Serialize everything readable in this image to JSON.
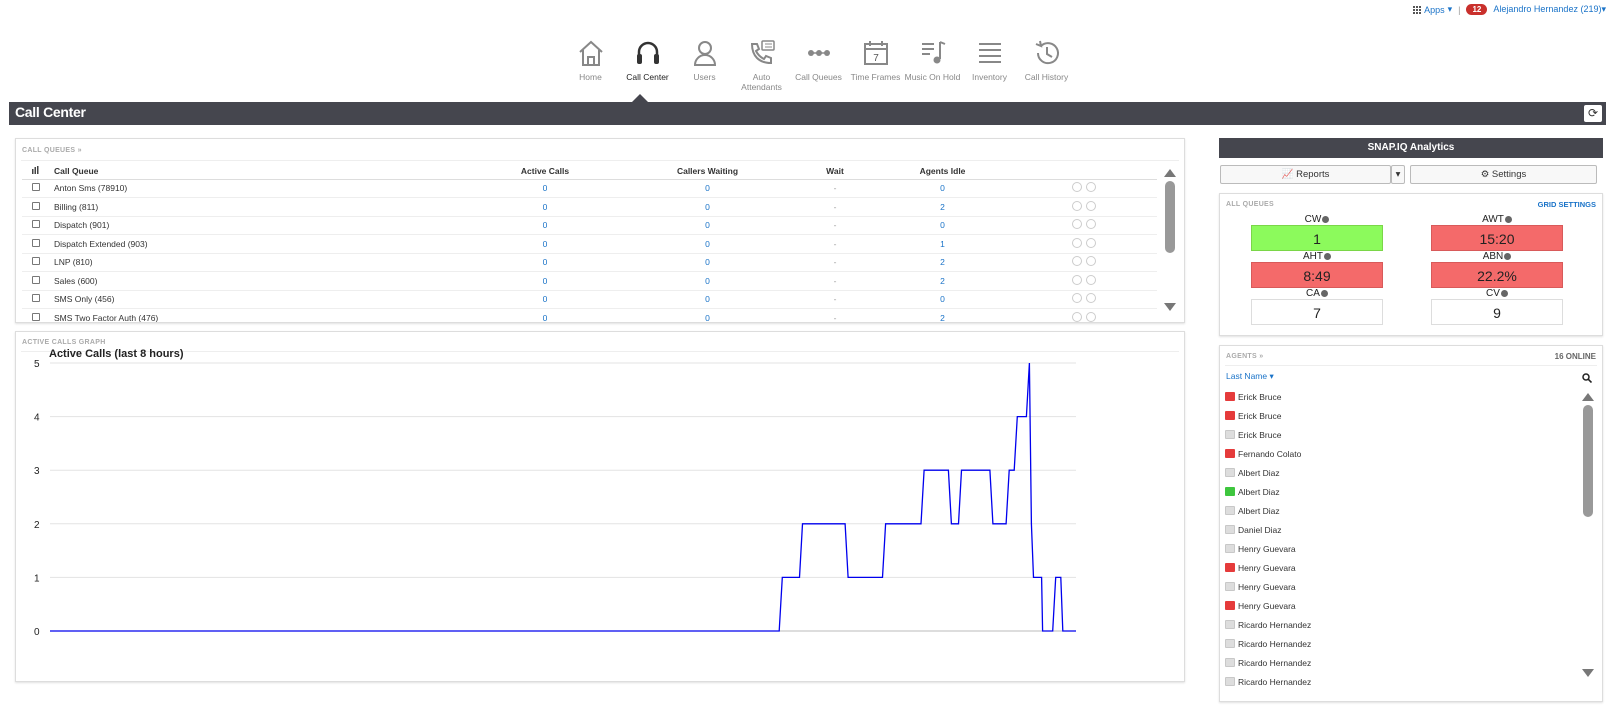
{
  "topbar": {
    "apps_label": "Apps",
    "notifications": "12",
    "user": "Alejandro Hernandez (219)"
  },
  "nav": [
    {
      "label": "Home",
      "icon": "home-icon"
    },
    {
      "label": "Call Center",
      "icon": "headset-icon"
    },
    {
      "label": "Users",
      "icon": "user-icon"
    },
    {
      "label": "Auto Attendants",
      "icon": "auto-attendant-icon"
    },
    {
      "label": "Call Queues",
      "icon": "call-queues-icon"
    },
    {
      "label": "Time Frames",
      "icon": "calendar-icon"
    },
    {
      "label": "Music On Hold",
      "icon": "music-icon"
    },
    {
      "label": "Inventory",
      "icon": "list-icon"
    },
    {
      "label": "Call History",
      "icon": "history-icon"
    }
  ],
  "page": {
    "title": "Call Center"
  },
  "queues": {
    "label": "CALL QUEUES »",
    "columns": [
      "Call Queue",
      "Active Calls",
      "Callers Waiting",
      "Wait",
      "Agents Idle"
    ],
    "rows": [
      {
        "name": "Anton Sms (78910)",
        "active": "0",
        "waiting": "0",
        "wait": "-",
        "idle": "0"
      },
      {
        "name": "Billing (811)",
        "active": "0",
        "waiting": "0",
        "wait": "-",
        "idle": "2"
      },
      {
        "name": "Dispatch (901)",
        "active": "0",
        "waiting": "0",
        "wait": "-",
        "idle": "0"
      },
      {
        "name": "Dispatch Extended (903)",
        "active": "0",
        "waiting": "0",
        "wait": "-",
        "idle": "1"
      },
      {
        "name": "LNP (810)",
        "active": "0",
        "waiting": "0",
        "wait": "-",
        "idle": "2"
      },
      {
        "name": "Sales (600)",
        "active": "0",
        "waiting": "0",
        "wait": "-",
        "idle": "2"
      },
      {
        "name": "SMS Only (456)",
        "active": "0",
        "waiting": "0",
        "wait": "-",
        "idle": "0"
      },
      {
        "name": "SMS Two Factor Auth (476)",
        "active": "0",
        "waiting": "0",
        "wait": "-",
        "idle": "2"
      }
    ]
  },
  "graph": {
    "label": "ACTIVE CALLS GRAPH",
    "chart_data": {
      "type": "line",
      "title": "Active Calls (last 8 hours)",
      "ylim": [
        0,
        5
      ],
      "yticks": [
        "0",
        "1",
        "2",
        "3",
        "4",
        "5"
      ],
      "x": [
        0,
        720,
        723,
        740,
        743,
        785,
        788,
        822,
        825,
        860,
        863,
        887,
        890,
        897,
        900,
        903,
        906,
        928,
        931,
        944,
        947,
        952,
        955,
        964,
        967,
        969,
        971,
        975,
        979,
        980,
        990,
        993,
        998,
        1000,
        1006,
        1009,
        1013
      ],
      "y": [
        0,
        0,
        1,
        1,
        2,
        2,
        1,
        1,
        2,
        2,
        3,
        3,
        2,
        2,
        3,
        3,
        3,
        3,
        2,
        2,
        3,
        3,
        4,
        4,
        5,
        2,
        1,
        1,
        1,
        0,
        0,
        1,
        1,
        0,
        0,
        0,
        0
      ],
      "color": "#0000ee",
      "grid": true
    }
  },
  "snap": {
    "header": "SNAP.IQ Analytics",
    "reports_label": "Reports",
    "settings_label": "Settings"
  },
  "allqueues": {
    "label": "ALL QUEUES",
    "grid_settings": "GRID SETTINGS",
    "metrics": [
      {
        "label": "CW",
        "value": "1",
        "status": "green"
      },
      {
        "label": "AWT",
        "value": "15:20",
        "status": "red"
      },
      {
        "label": "AHT",
        "value": "8:49",
        "status": "red"
      },
      {
        "label": "ABN",
        "value": "22.2%",
        "status": "red"
      },
      {
        "label": "CA",
        "value": "7",
        "status": "neutral"
      },
      {
        "label": "CV",
        "value": "9",
        "status": "neutral"
      }
    ]
  },
  "agents": {
    "label": "AGENTS »",
    "online": "16 ONLINE",
    "sort_label": "Last Name",
    "list": [
      {
        "name": "Erick Bruce",
        "status": "red"
      },
      {
        "name": "Erick Bruce",
        "status": "red"
      },
      {
        "name": "Erick Bruce",
        "status": "grey"
      },
      {
        "name": "Fernando Colato",
        "status": "red"
      },
      {
        "name": "Albert Diaz",
        "status": "grey"
      },
      {
        "name": "Albert Diaz",
        "status": "green"
      },
      {
        "name": "Albert Diaz",
        "status": "grey"
      },
      {
        "name": "Daniel Diaz",
        "status": "grey"
      },
      {
        "name": "Henry Guevara",
        "status": "grey"
      },
      {
        "name": "Henry Guevara",
        "status": "red"
      },
      {
        "name": "Henry Guevara",
        "status": "grey"
      },
      {
        "name": "Henry Guevara",
        "status": "red"
      },
      {
        "name": "Ricardo Hernandez",
        "status": "grey"
      },
      {
        "name": "Ricardo Hernandez",
        "status": "grey"
      },
      {
        "name": "Ricardo Hernandez",
        "status": "grey"
      },
      {
        "name": "Ricardo Hernandez",
        "status": "grey"
      }
    ]
  }
}
